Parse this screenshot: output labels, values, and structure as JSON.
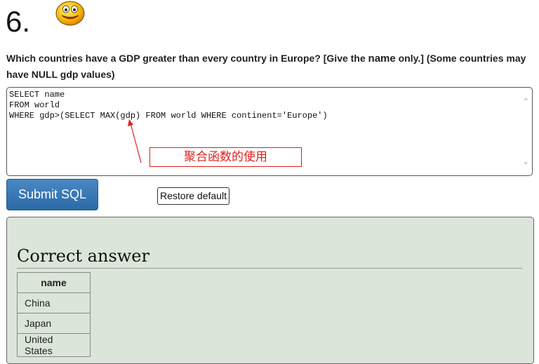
{
  "question": {
    "number": "6.",
    "text_part1": "Which countries have a GDP greater than every country in Europe? [Give the ",
    "keyword": "name",
    "text_part2": " only.] (Some countries may have NULL gdp values)"
  },
  "editor": {
    "code": "SELECT name\nFROM world\nWHERE gdp>(SELECT MAX(gdp) FROM world WHERE continent='Europe')"
  },
  "annotation": {
    "text": "聚合函数的使用",
    "color": "#e02020"
  },
  "buttons": {
    "submit_label": "Submit SQL",
    "restore_label": "Restore default"
  },
  "answer": {
    "title": "Correct answer",
    "columns": [
      "name"
    ],
    "rows": [
      "China",
      "Japan",
      "United States"
    ]
  },
  "colors": {
    "submit_bg": "#2a6aa8",
    "panel_bg": "#dbe5d9"
  },
  "icons": {
    "smiley": "smiley-face-icon"
  }
}
